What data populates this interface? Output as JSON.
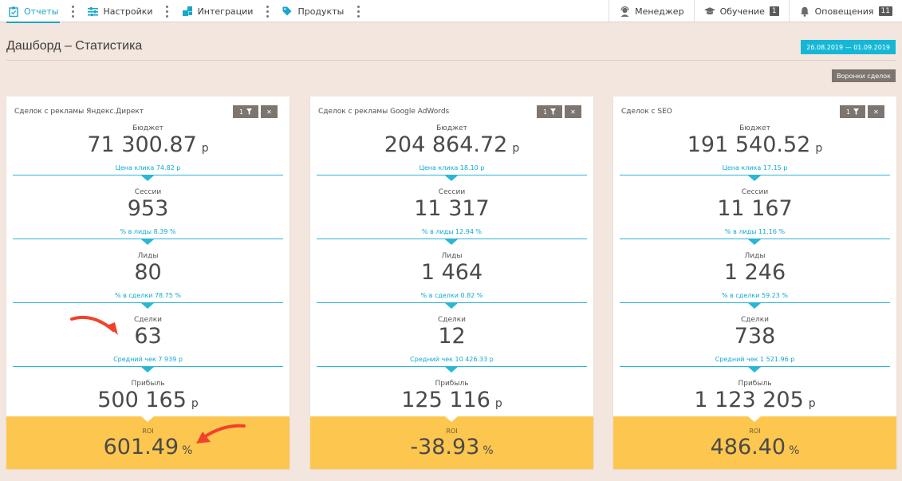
{
  "nav": {
    "left": [
      {
        "label": "Отчеты",
        "icon": "clipboard-icon"
      },
      {
        "label": "Настройки",
        "icon": "sliders-icon"
      },
      {
        "label": "Интеграции",
        "icon": "puzzle-icon"
      },
      {
        "label": "Продукты",
        "icon": "tag-icon"
      }
    ],
    "right": [
      {
        "label": "Менеджер",
        "icon": "headset-icon"
      },
      {
        "label": "Обучение",
        "icon": "graduation-cap-icon",
        "badge": "1"
      },
      {
        "label": "Оповещения",
        "icon": "bell-icon",
        "badge": "11"
      }
    ]
  },
  "header": {
    "title": "Дашборд – Статистика",
    "date_range": "26.08.2019  —  01.09.2019",
    "funnels_button": "Воронки сделок"
  },
  "cards": [
    {
      "title": "Сделок с рекламы Яндекс.Директ",
      "filter_count": "1",
      "close": "✕",
      "budget_label": "Бюджет",
      "budget_value": "71 300.87",
      "budget_unit": "р",
      "click_price": "Цена клика 74.82 р",
      "sessions_label": "Сессии",
      "sessions_value": "953",
      "to_leads": "% в лиды 8.39 %",
      "leads_label": "Лиды",
      "leads_value": "80",
      "to_deals": "% в сделки 78.75 %",
      "deals_label": "Сделки",
      "deals_value": "63",
      "avg_check": "Средний чек 7 939 р",
      "profit_label": "Прибыль",
      "profit_value": "500 165",
      "profit_unit": "р",
      "roi_label": "ROI",
      "roi_value": "601.49",
      "roi_unit": "%"
    },
    {
      "title": "Сделок с рекламы Google AdWords",
      "filter_count": "1",
      "close": "✕",
      "budget_label": "Бюджет",
      "budget_value": "204 864.72",
      "budget_unit": "р",
      "click_price": "Цена клика 18.10 р",
      "sessions_label": "Сессии",
      "sessions_value": "11 317",
      "to_leads": "% в лиды 12.94 %",
      "leads_label": "Лиды",
      "leads_value": "1 464",
      "to_deals": "% в сделки 0.82 %",
      "deals_label": "Сделки",
      "deals_value": "12",
      "avg_check": "Средний чек 10 426.33 р",
      "profit_label": "Прибыль",
      "profit_value": "125 116",
      "profit_unit": "р",
      "roi_label": "ROI",
      "roi_value": "-38.93",
      "roi_unit": "%"
    },
    {
      "title": "Сделок с SEO",
      "filter_count": "1",
      "close": "✕",
      "budget_label": "Бюджет",
      "budget_value": "191 540.52",
      "budget_unit": "р",
      "click_price": "Цена клика 17.15 р",
      "sessions_label": "Сессии",
      "sessions_value": "11 167",
      "to_leads": "% в лиды 11.16 %",
      "leads_label": "Лиды",
      "leads_value": "1 246",
      "to_deals": "% в сделки 59.23 %",
      "deals_label": "Сделки",
      "deals_value": "738",
      "avg_check": "Средний чек 1 521.96 р",
      "profit_label": "Прибыль",
      "profit_value": "1 123 205",
      "profit_unit": "р",
      "roi_label": "ROI",
      "roi_value": "486.40",
      "roi_unit": "%"
    }
  ],
  "colors": {
    "accent": "#16b7d6",
    "roi_background": "#fdc64f",
    "page_background": "#f2e6de",
    "annotation_arrow": "#f0432a"
  }
}
